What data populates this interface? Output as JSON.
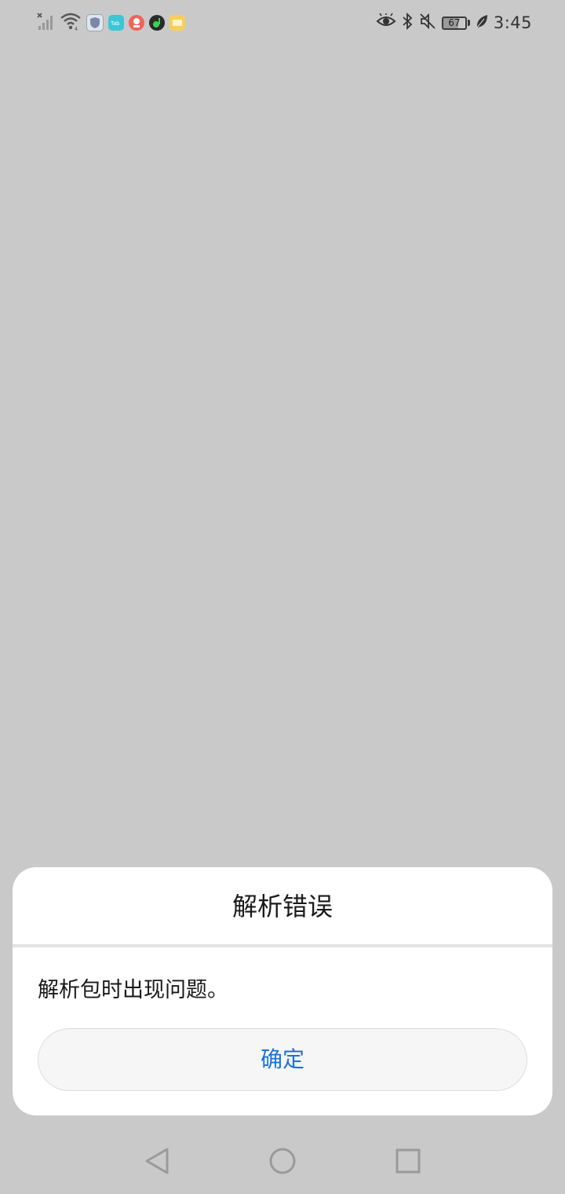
{
  "status_bar": {
    "left_icons": [
      "no-signal-icon",
      "wifi-icon",
      "shield-app-icon",
      "tab-app-icon",
      "red-app-icon",
      "music-app-icon",
      "yellow-app-icon"
    ],
    "right_icons": [
      "eye-icon",
      "bluetooth-icon",
      "mute-icon",
      "battery-icon",
      "leaf-icon"
    ],
    "battery_level": "67",
    "time": "3:45"
  },
  "dialog": {
    "title": "解析错误",
    "message": "解析包时出现问题。",
    "confirm_label": "确定",
    "accent_color": "#1a73d9"
  },
  "nav_bar": {
    "buttons": [
      "back-icon",
      "home-icon",
      "recents-icon"
    ]
  }
}
